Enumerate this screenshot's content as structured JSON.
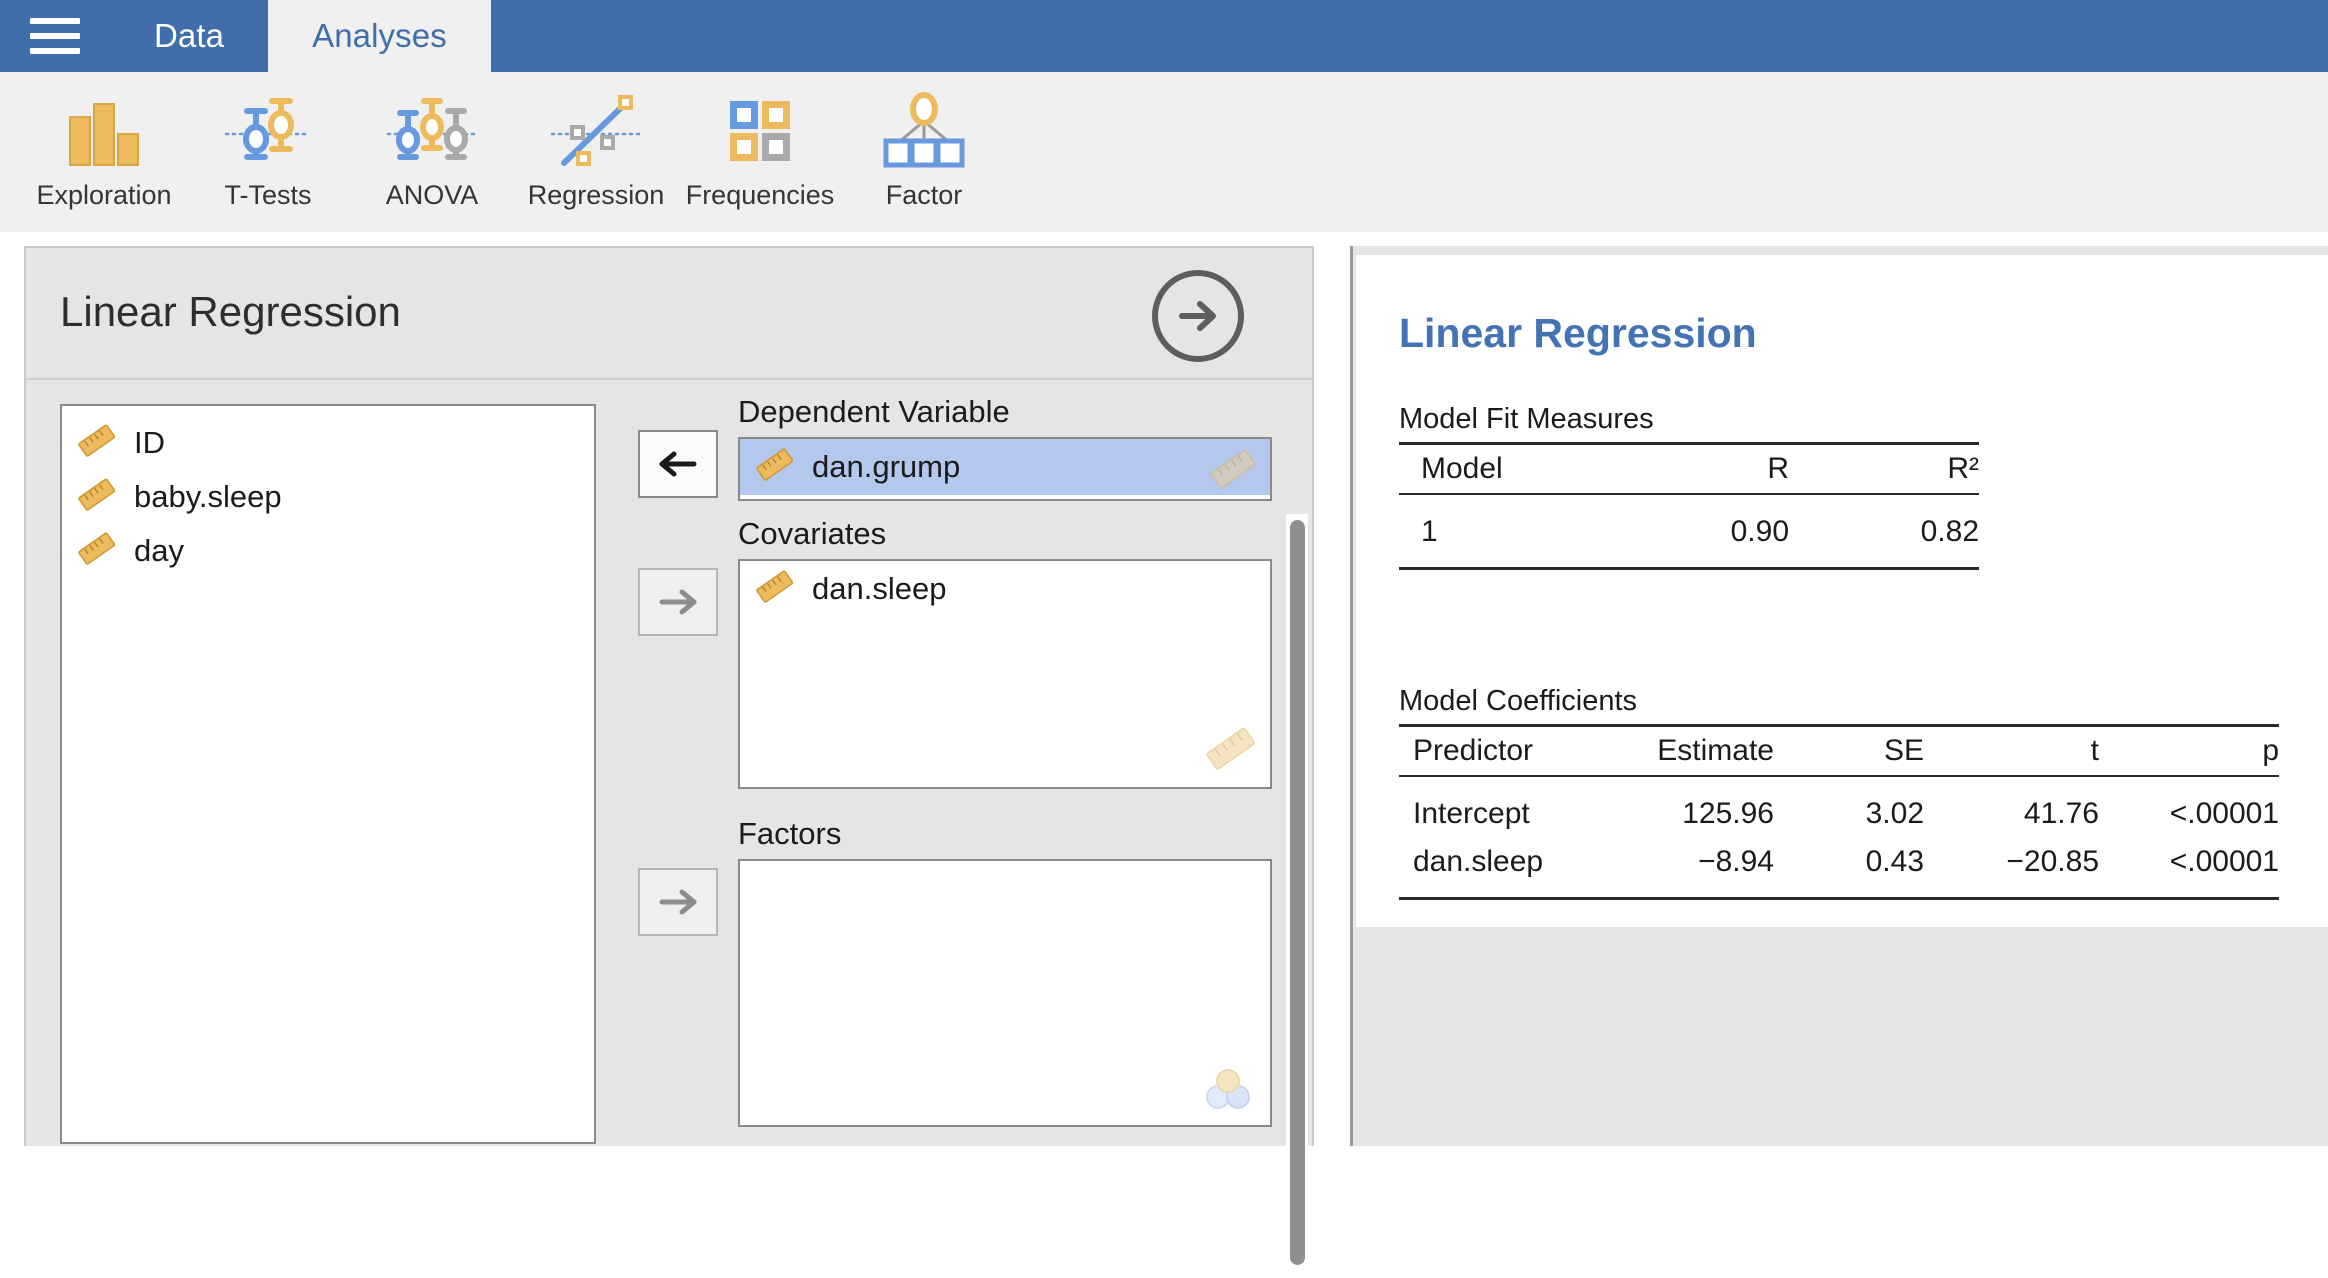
{
  "titlebar": {
    "menu_icon": "hamburger-menu-icon",
    "tabs": [
      {
        "label": "Data",
        "active": false
      },
      {
        "label": "Analyses",
        "active": true
      }
    ]
  },
  "ribbon": {
    "items": [
      {
        "label": "Exploration",
        "icon": "bar-chart-icon"
      },
      {
        "label": "T-Tests",
        "icon": "two-group-errorbar-icon"
      },
      {
        "label": "ANOVA",
        "icon": "three-group-errorbar-icon"
      },
      {
        "label": "Regression",
        "icon": "scatter-trendline-icon"
      },
      {
        "label": "Frequencies",
        "icon": "contingency-grid-icon"
      },
      {
        "label": "Factor",
        "icon": "factor-tree-icon"
      }
    ]
  },
  "options_panel": {
    "title": "Linear Regression",
    "collapse_icon": "arrow-right-circle-icon",
    "available_variables": [
      {
        "name": "ID",
        "type": "continuous"
      },
      {
        "name": "baby.sleep",
        "type": "continuous"
      },
      {
        "name": "day",
        "type": "continuous"
      }
    ],
    "transfer_buttons": [
      {
        "name": "dependent-transfer",
        "glyph": "←",
        "enabled": true
      },
      {
        "name": "covariates-transfer",
        "glyph": "→",
        "enabled": false
      },
      {
        "name": "factors-transfer",
        "glyph": "→",
        "enabled": false
      }
    ],
    "boxes": [
      {
        "label": "Dependent Variable",
        "hint_icon": "continuous-ruler-icon",
        "items": [
          {
            "name": "dan.grump",
            "type": "continuous",
            "selected": true
          }
        ]
      },
      {
        "label": "Covariates",
        "hint_icon": "continuous-ruler-icon",
        "items": [
          {
            "name": "dan.sleep",
            "type": "continuous",
            "selected": false
          }
        ]
      },
      {
        "label": "Factors",
        "hint_icon": "nominal-circles-icon",
        "items": []
      }
    ]
  },
  "results": {
    "title": "Linear Regression",
    "model_fit": {
      "caption": "Model Fit Measures",
      "columns": [
        "Model",
        "R",
        "R²"
      ],
      "rows": [
        [
          "1",
          "0.90",
          "0.82"
        ]
      ]
    },
    "model_coefficients": {
      "caption": "Model Coefficients",
      "columns": [
        "Predictor",
        "Estimate",
        "SE",
        "t",
        "p"
      ],
      "rows": [
        [
          "Intercept",
          "125.96",
          "3.02",
          "41.76",
          "<.00001"
        ],
        [
          "dan.sleep",
          "−8.94",
          "0.43",
          "−20.85",
          "<.00001"
        ]
      ]
    }
  },
  "colors": {
    "header_blue": "#3f6eab",
    "ribbon_bg": "#f0f0f0",
    "panel_bg": "#e5e5e5",
    "accent_orange": "#eab74e",
    "accent_blue": "#6699dd",
    "accent_gray": "#a9a9a9",
    "selection_blue": "#b4c7ec",
    "results_title_blue": "#4372b5"
  }
}
